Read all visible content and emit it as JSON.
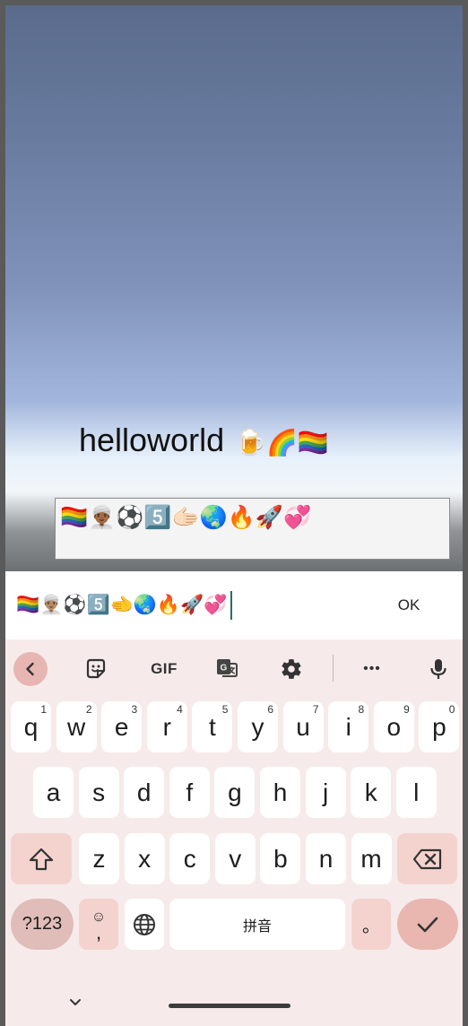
{
  "scene": {
    "title_text": "helloworld",
    "title_emoji": "🍺🌈🏳️‍🌈",
    "field_value": "🏳️‍🌈👳🏾‍♂️⚽5️⃣🫱🏻🌏🔥🚀💞"
  },
  "input_bar": {
    "value": "🏳️‍🌈👳🏽‍♂️⚽5️⃣🫲🌏🔥🚀💞",
    "ok_label": "OK"
  },
  "toolbar": {
    "items": [
      "back-icon",
      "sticker-icon",
      "GIF",
      "translate-icon",
      "gear-icon",
      "more-icon",
      "mic-icon"
    ],
    "gif_label": "GIF",
    "more_label": "•••"
  },
  "keyboard": {
    "row1": [
      {
        "key": "q",
        "hint": "1"
      },
      {
        "key": "w",
        "hint": "2"
      },
      {
        "key": "e",
        "hint": "3"
      },
      {
        "key": "r",
        "hint": "4"
      },
      {
        "key": "t",
        "hint": "5"
      },
      {
        "key": "y",
        "hint": "6"
      },
      {
        "key": "u",
        "hint": "7"
      },
      {
        "key": "i",
        "hint": "8"
      },
      {
        "key": "o",
        "hint": "9"
      },
      {
        "key": "p",
        "hint": "0"
      }
    ],
    "row2": [
      "a",
      "s",
      "d",
      "f",
      "g",
      "h",
      "j",
      "k",
      "l"
    ],
    "row3": [
      "z",
      "x",
      "c",
      "v",
      "b",
      "n",
      "m"
    ],
    "numbers_label": "?123",
    "emoji_key_symbol": "☺",
    "comma_label": ",",
    "space_label": "拼音",
    "period_label": "。"
  }
}
